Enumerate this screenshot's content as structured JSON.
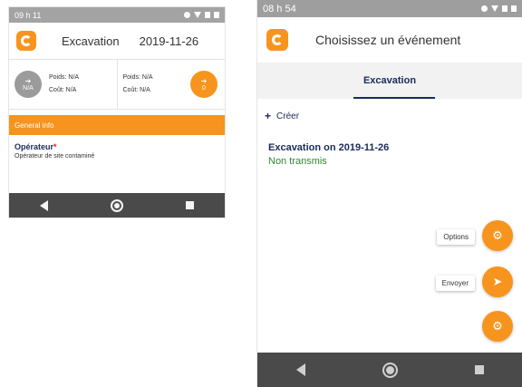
{
  "left_screen": {
    "status_time": "09 h 11",
    "header": {
      "title": "Excavation",
      "date": "2019-11-26"
    },
    "summary": {
      "in_button_value": "N/A",
      "in_weight": "Poids: N/A",
      "in_cost": "Coût: N/A",
      "out_weight": "Poids: N/A",
      "out_cost": "Coût: N/A",
      "out_button_value": "0"
    },
    "section_title": "General info",
    "field": {
      "label": "Opérateur",
      "required_mark": "*",
      "value": "Opérateur de site contaminé"
    }
  },
  "right_screen": {
    "status_time": "08 h 54",
    "header_title": "Choisissez un événement",
    "tab_label": "Excavation",
    "create_label": "Créer",
    "event": {
      "name": "Excavation on 2019-11-26",
      "status": "Non transmis"
    },
    "fab_options_label": "Options",
    "fab_send_label": "Envoyer"
  },
  "colors": {
    "accent": "#f7941d",
    "navy": "#1a2b5a",
    "success": "#2e8b2e",
    "statusbar": "#a3a3a3",
    "navbar": "#4a4a4a"
  }
}
